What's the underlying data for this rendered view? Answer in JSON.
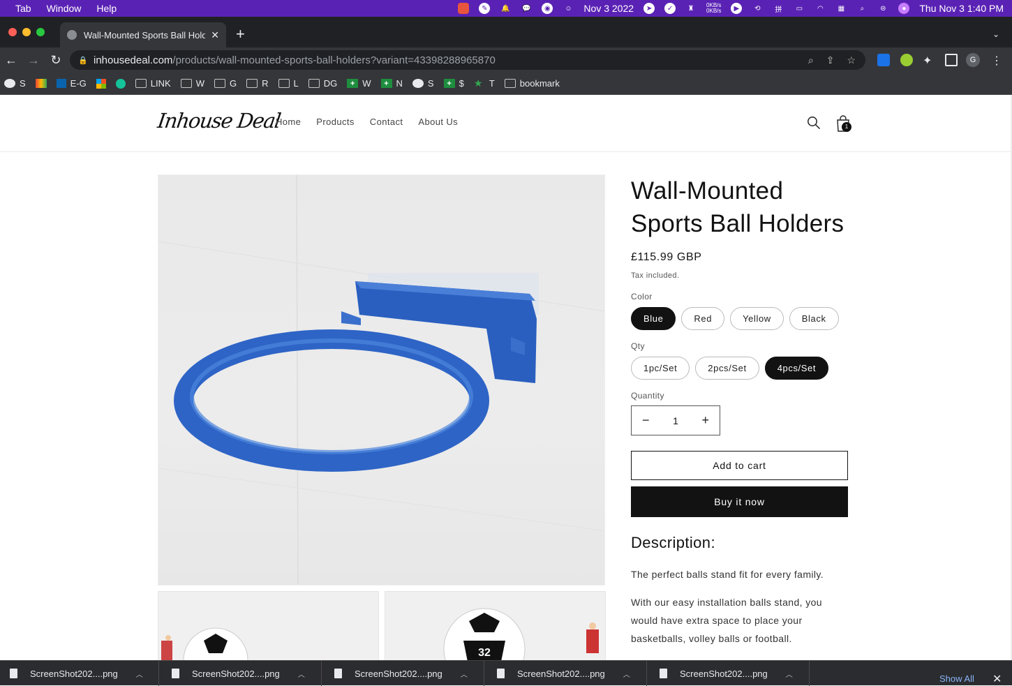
{
  "menubar": {
    "items": [
      "Tab",
      "Window",
      "Help"
    ],
    "date_widget": "Nov 3 2022",
    "net_up": "0KB/s",
    "net_down": "0KB/s",
    "clock": "Thu Nov 3  1:40 PM"
  },
  "browser": {
    "tab_title": "Wall-Mounted Sports Ball Holders",
    "url_host": "inhousedeal.com",
    "url_path": "/products/wall-mounted-sports-ball-holders?variant=43398288965870",
    "profile_initial": "G",
    "bookmarks": [
      {
        "icon": "globe-icon",
        "label": "S"
      },
      {
        "icon": "gmail-icon",
        "label": ""
      },
      {
        "icon": "outlook-icon",
        "label": "E-G"
      },
      {
        "icon": "microsoft-icon",
        "label": ""
      },
      {
        "icon": "grammarly-icon",
        "label": ""
      },
      {
        "icon": "folder-icon",
        "label": "LINK"
      },
      {
        "icon": "folder-icon",
        "label": "W"
      },
      {
        "icon": "folder-icon",
        "label": "G"
      },
      {
        "icon": "folder-icon",
        "label": "R"
      },
      {
        "icon": "folder-icon",
        "label": "L"
      },
      {
        "icon": "folder-icon",
        "label": "DG"
      },
      {
        "icon": "sheets-icon",
        "label": "W"
      },
      {
        "icon": "sheets-icon",
        "label": "N"
      },
      {
        "icon": "globe-icon",
        "label": "S"
      },
      {
        "icon": "sheets-icon",
        "label": "$"
      },
      {
        "icon": "star-icon",
        "label": "T"
      },
      {
        "icon": "folder-icon",
        "label": "bookmark"
      }
    ]
  },
  "site": {
    "logo": "Inhouse Deal",
    "nav": [
      "Home",
      "Products",
      "Contact",
      "About Us"
    ],
    "cart_count": "1"
  },
  "product": {
    "title": "Wall-Mounted Sports Ball Holders",
    "price": "£115.99 GBP",
    "tax_note": "Tax included.",
    "color_label": "Color",
    "colors": [
      "Blue",
      "Red",
      "Yellow",
      "Black"
    ],
    "selected_color": "Blue",
    "qty_option_label": "Qty",
    "qty_options": [
      "1pc/Set",
      "2pcs/Set",
      "4pcs/Set"
    ],
    "selected_qty_option": "4pcs/Set",
    "quantity_label": "Quantity",
    "quantity_value": "1",
    "quantity_minus": "−",
    "quantity_plus": "+",
    "add_to_cart": "Add to cart",
    "buy_now": "Buy it now",
    "description_heading": "Description:",
    "description_p1": "The perfect balls stand fit for every family.",
    "description_p2": "With our easy installation balls stand, you would have extra space to place your basketballs, volley balls or football.",
    "thumb_jersey_number": "32"
  },
  "downloads": {
    "items": [
      "ScreenShot202....png",
      "ScreenShot202....png",
      "ScreenShot202....png",
      "ScreenShot202....png",
      "ScreenShot202....png"
    ],
    "show_all": "Show All"
  },
  "colors": {
    "menubar_bg": "#5a22b4",
    "product_blue": "#2f66c9",
    "button_black": "#121212"
  }
}
